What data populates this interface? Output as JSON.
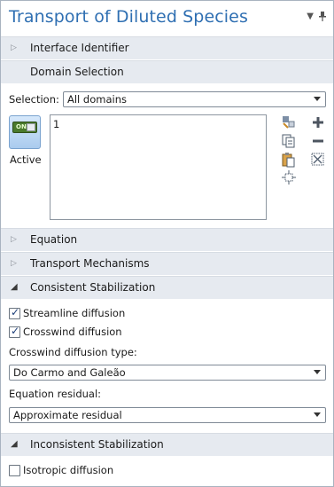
{
  "panel": {
    "title": "Transport of Diluted Species",
    "pin_icon": "pin-icon",
    "menu_icon": "dropdown-arrow-icon"
  },
  "sections": {
    "interface_identifier": "Interface Identifier",
    "domain_selection": "Domain Selection",
    "equation": "Equation",
    "transport_mechanisms": "Transport Mechanisms",
    "consistent_stabilization": "Consistent Stabilization",
    "inconsistent_stabilization": "Inconsistent Stabilization"
  },
  "domain_selection": {
    "selection_label": "Selection:",
    "selection_value": "All domains",
    "active_toggle_text": "ON",
    "active_label": "Active",
    "list_items": [
      "1"
    ],
    "tools": [
      "select-mode-icon",
      "copy-icon",
      "paste-icon",
      "zoom-to-selection-icon",
      "add-icon",
      "remove-icon",
      "clear-selection-icon"
    ]
  },
  "consistent": {
    "streamline_label": "Streamline diffusion",
    "streamline_checked": true,
    "crosswind_label": "Crosswind diffusion",
    "crosswind_checked": true,
    "crosswind_type_label": "Crosswind diffusion type:",
    "crosswind_type_value": "Do Carmo and Galeão",
    "residual_label": "Equation residual:",
    "residual_value": "Approximate residual"
  },
  "inconsistent": {
    "isotropic_label": "Isotropic diffusion",
    "isotropic_checked": false
  },
  "colors": {
    "title": "#2f6fb2",
    "section_bg": "#e6eaf0",
    "toggle_on": "#4a7a2c"
  }
}
